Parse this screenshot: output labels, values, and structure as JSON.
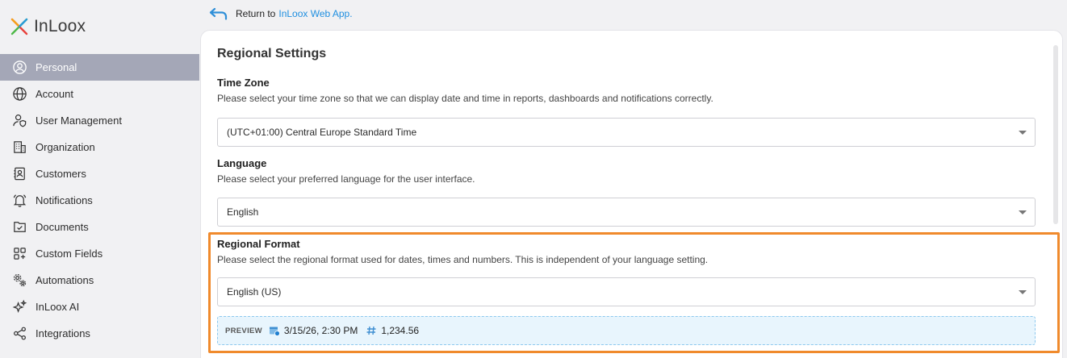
{
  "app": {
    "logo_text": "InLoox"
  },
  "return_link": {
    "prefix": "Return to",
    "link": "InLoox Web App."
  },
  "sidebar": {
    "items": [
      {
        "label": "Personal",
        "icon": "user-circle-icon",
        "active": true
      },
      {
        "label": "Account",
        "icon": "globe-icon"
      },
      {
        "label": "User Management",
        "icon": "user-shield-icon"
      },
      {
        "label": "Organization",
        "icon": "building-icon"
      },
      {
        "label": "Customers",
        "icon": "contact-card-icon"
      },
      {
        "label": "Notifications",
        "icon": "bell-icon"
      },
      {
        "label": "Documents",
        "icon": "document-check-icon"
      },
      {
        "label": "Custom Fields",
        "icon": "grid-plus-icon"
      },
      {
        "label": "Automations",
        "icon": "gears-icon"
      },
      {
        "label": "InLoox AI",
        "icon": "sparkle-icon"
      },
      {
        "label": "Integrations",
        "icon": "share-nodes-icon"
      }
    ]
  },
  "main": {
    "title": "Regional Settings",
    "time_zone": {
      "title": "Time Zone",
      "description": "Please select your time zone so that we can display date and time in reports, dashboards and notifications correctly.",
      "value": "(UTC+01:00) Central Europe Standard Time"
    },
    "language": {
      "title": "Language",
      "description": "Please select your preferred language for the user interface.",
      "value": "English"
    },
    "regional_format": {
      "title": "Regional Format",
      "description": "Please select the regional format used for dates, times and numbers. This is independent of your language setting.",
      "value": "English (US)"
    },
    "preview": {
      "label": "PREVIEW",
      "datetime": "3/15/26, 2:30 PM",
      "number": "1,234.56"
    }
  },
  "colors": {
    "active_nav": "#a4a7b7",
    "link": "#1f8fe0",
    "highlight": "#f08a2c",
    "preview_bg": "#e8f5fd"
  }
}
